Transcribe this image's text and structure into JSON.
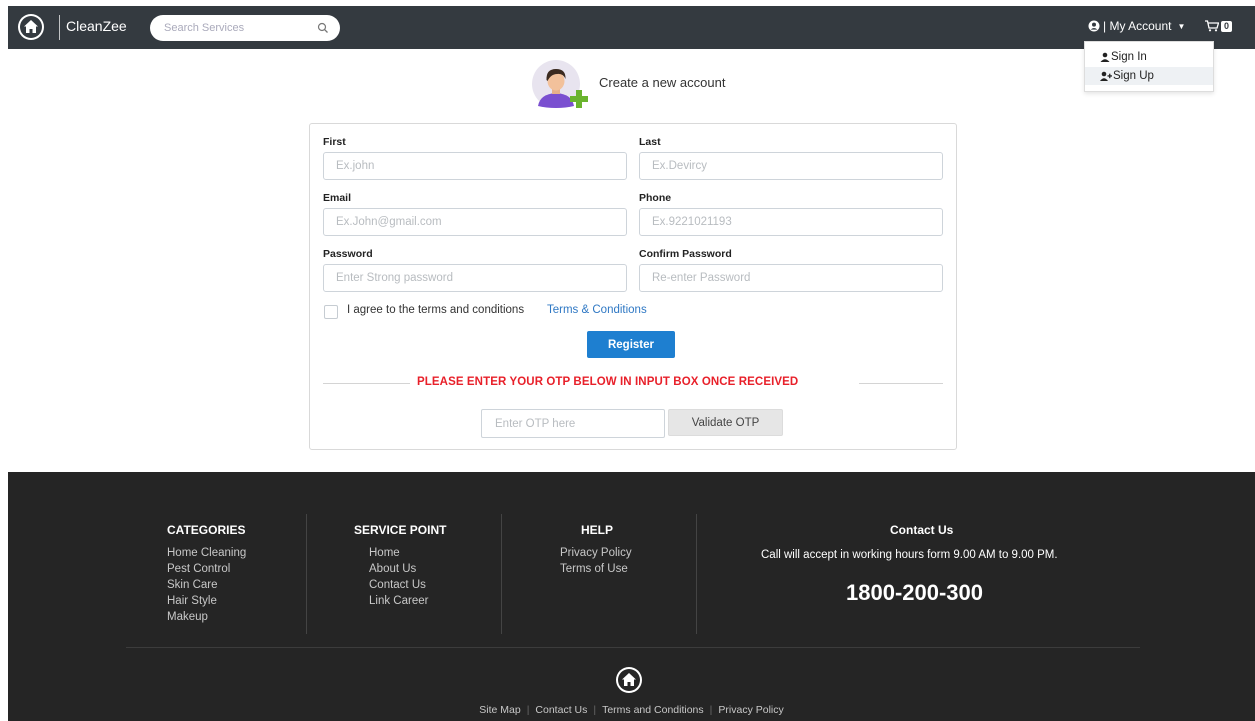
{
  "header": {
    "brand": "CleanZee",
    "search_placeholder": "Search Services",
    "account_label": "| My Account",
    "cart_count": "0",
    "account_menu": [
      {
        "label": "Sign In",
        "icon": "user-icon"
      },
      {
        "label": "Sign Up",
        "icon": "user-plus-icon"
      }
    ]
  },
  "page": {
    "title": "Create a new account"
  },
  "form": {
    "first_label": "First",
    "first_placeholder": "Ex.john",
    "last_label": "Last",
    "last_placeholder": "Ex.Devircy",
    "email_label": "Email",
    "email_placeholder": "Ex.John@gmail.com",
    "phone_label": "Phone",
    "phone_placeholder": "Ex.9221021193",
    "password_label": "Password",
    "password_placeholder": "Enter Strong password",
    "confirm_label": "Confirm Password",
    "confirm_placeholder": "Re-enter Password",
    "agree_text": "I agree to the terms and conditions",
    "terms_link": "Terms & Conditions",
    "register_label": "Register",
    "otp_message": "PLEASE ENTER YOUR OTP BELOW IN INPUT BOX ONCE RECEIVED",
    "otp_placeholder": "Enter OTP here",
    "validate_label": "Validate OTP"
  },
  "footer": {
    "categories": {
      "heading": "CATEGORIES",
      "items": [
        "Home Cleaning",
        "Pest Control",
        "Skin Care",
        "Hair Style",
        "Makeup"
      ]
    },
    "service_point": {
      "heading": "SERVICE POINT",
      "items": [
        "Home",
        "About Us",
        "Contact Us",
        "Link Career"
      ]
    },
    "help": {
      "heading": "HELP",
      "items": [
        "Privacy Policy",
        "Terms of Use"
      ]
    },
    "contact": {
      "heading": "Contact Us",
      "description": "Call will accept in working hours form 9.00 AM to 9.00 PM.",
      "phone": "1800-200-300"
    },
    "bottom_links": [
      "Site Map",
      "Contact Us",
      "Terms and Conditions",
      "Privacy Policy"
    ]
  },
  "colors": {
    "navbar": "#343a40",
    "footer": "#252525",
    "primary": "#1e7fd0",
    "alert": "#e8202a",
    "link": "#2f78c4"
  }
}
